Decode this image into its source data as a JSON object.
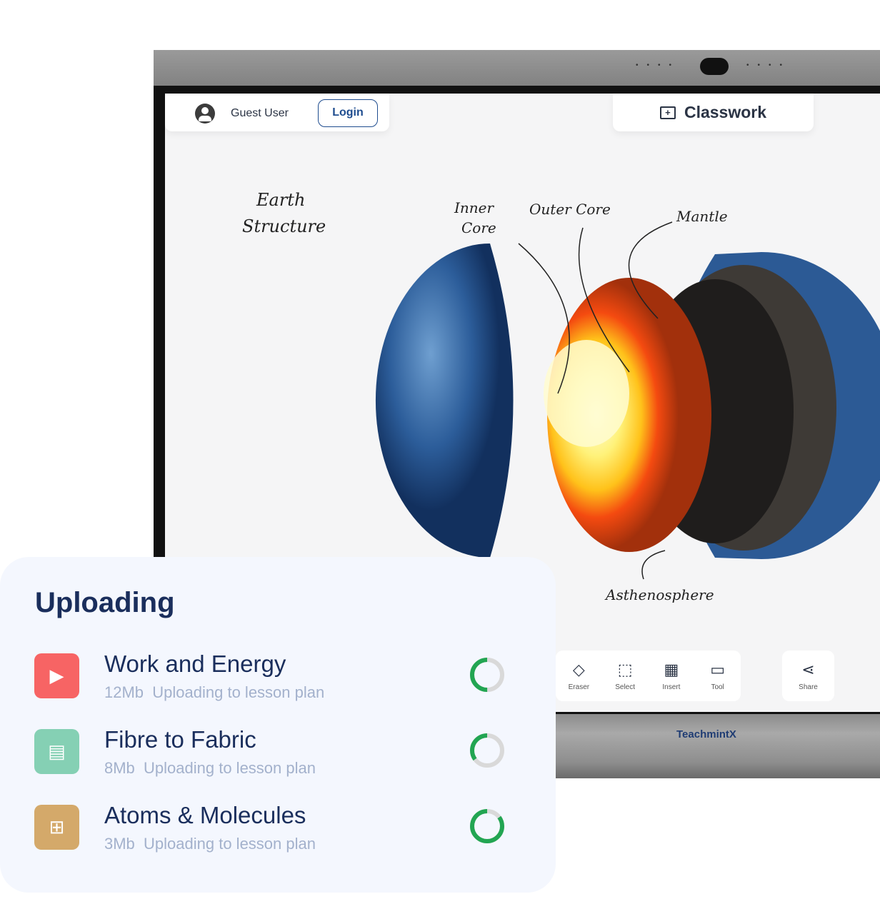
{
  "header": {
    "user_name": "Guest User",
    "login_label": "Login",
    "classwork_label": "Classwork"
  },
  "board": {
    "title_line1": "Earth",
    "title_line2": "Structure",
    "labels": {
      "inner_core_1": "Inner",
      "inner_core_2": "Core",
      "outer_core": "Outer Core",
      "mantle": "Mantle",
      "asthenosphere": "Asthenosphere"
    }
  },
  "toolbar": {
    "tools": [
      {
        "label": "Eraser",
        "icon": "eraser-icon"
      },
      {
        "label": "Select",
        "icon": "select-icon"
      },
      {
        "label": "Insert",
        "icon": "insert-icon"
      },
      {
        "label": "Tool",
        "icon": "toolbox-icon"
      }
    ],
    "share_label": "Share"
  },
  "brand": "TeachmintX",
  "uploading": {
    "title": "Uploading",
    "items": [
      {
        "name": "Work and Energy",
        "size": "12Mb",
        "status": "Uploading to lesson plan",
        "icon": "video-icon",
        "color": "#f76464",
        "progress": 50
      },
      {
        "name": "Fibre to Fabric",
        "size": "8Mb",
        "status": "Uploading to lesson plan",
        "icon": "folder-icon",
        "color": "#85d0b4",
        "progress": 35
      },
      {
        "name": "Atoms & Molecules",
        "size": "3Mb",
        "status": "Uploading to lesson plan",
        "icon": "whiteboard-icon",
        "color": "#d4a96a",
        "progress": 85
      }
    ]
  },
  "colors": {
    "progress": "#22a552",
    "track": "#d9d9d9",
    "title": "#1a2e5c"
  }
}
